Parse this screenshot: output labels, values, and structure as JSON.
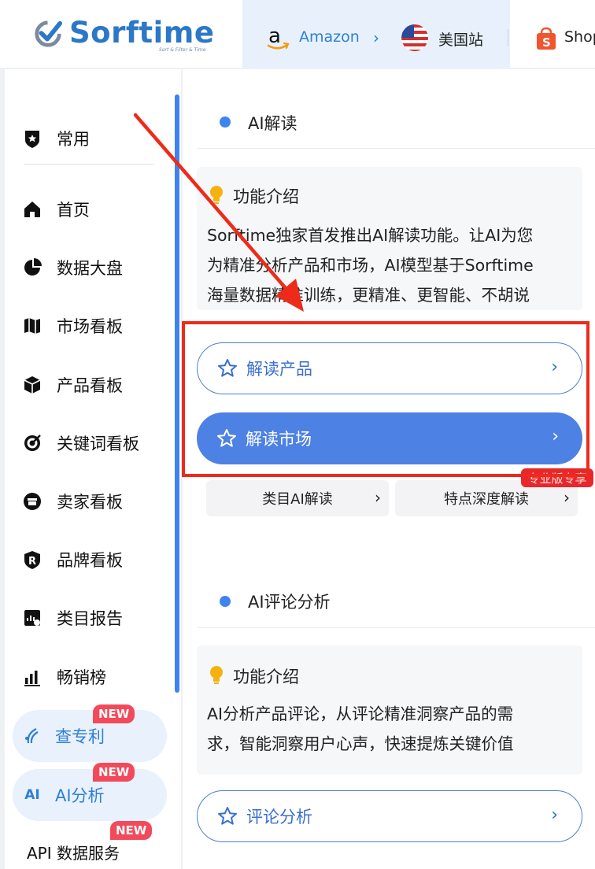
{
  "header": {
    "brand": "Sorftime",
    "slogan": "Sort & Filter & Time",
    "marketplace": "Amazon",
    "site": "美国站",
    "shop": "Shop"
  },
  "sidebar": {
    "items": [
      {
        "label": "常用",
        "icon": "shield-star-icon"
      },
      {
        "label": "首页",
        "icon": "home-icon"
      },
      {
        "label": "数据大盘",
        "icon": "pie-chart-icon"
      },
      {
        "label": "市场看板",
        "icon": "map-icon"
      },
      {
        "label": "产品看板",
        "icon": "box-icon"
      },
      {
        "label": "关键词看板",
        "icon": "target-icon"
      },
      {
        "label": "卖家看板",
        "icon": "store-icon"
      },
      {
        "label": "品牌看板",
        "icon": "brand-r-icon"
      },
      {
        "label": "类目报告",
        "icon": "report-icon"
      },
      {
        "label": "畅销榜",
        "icon": "bar-chart-icon"
      }
    ],
    "patent": {
      "label": "查专利",
      "badge": "NEW",
      "icon": "patent-icon"
    },
    "ai": {
      "label": "AI分析",
      "badge": "NEW",
      "icon_text": "AI"
    },
    "api": {
      "label": "API 数据服务",
      "badge": "NEW"
    }
  },
  "sections": {
    "ai_read": {
      "title": "AI解读",
      "intro_title": "功能介绍",
      "intro_lines": [
        "Sorftime独家首发推出AI解读功能。让AI为您",
        "为精准分析产品和市场，AI模型基于Sorftime",
        "海量数据精准训练，更精准、更智能、不胡说"
      ],
      "btn_product": "解读产品",
      "btn_market": "解读市场",
      "sub_category": "类目AI解读",
      "sub_feature": "特点深度解读",
      "pro_badge": "专业版专享"
    },
    "ai_review": {
      "title": "AI评论分析",
      "intro_title": "功能介绍",
      "intro_lines": [
        "AI分析产品评论，从评论精准洞察产品的需",
        "求，智能洞察用户心声，快速提炼关键价值"
      ],
      "btn_review": "评论分析"
    }
  },
  "colors": {
    "accent": "#3d84f0",
    "brand": "#2c78c6",
    "annotation": "#ee2b1b"
  }
}
